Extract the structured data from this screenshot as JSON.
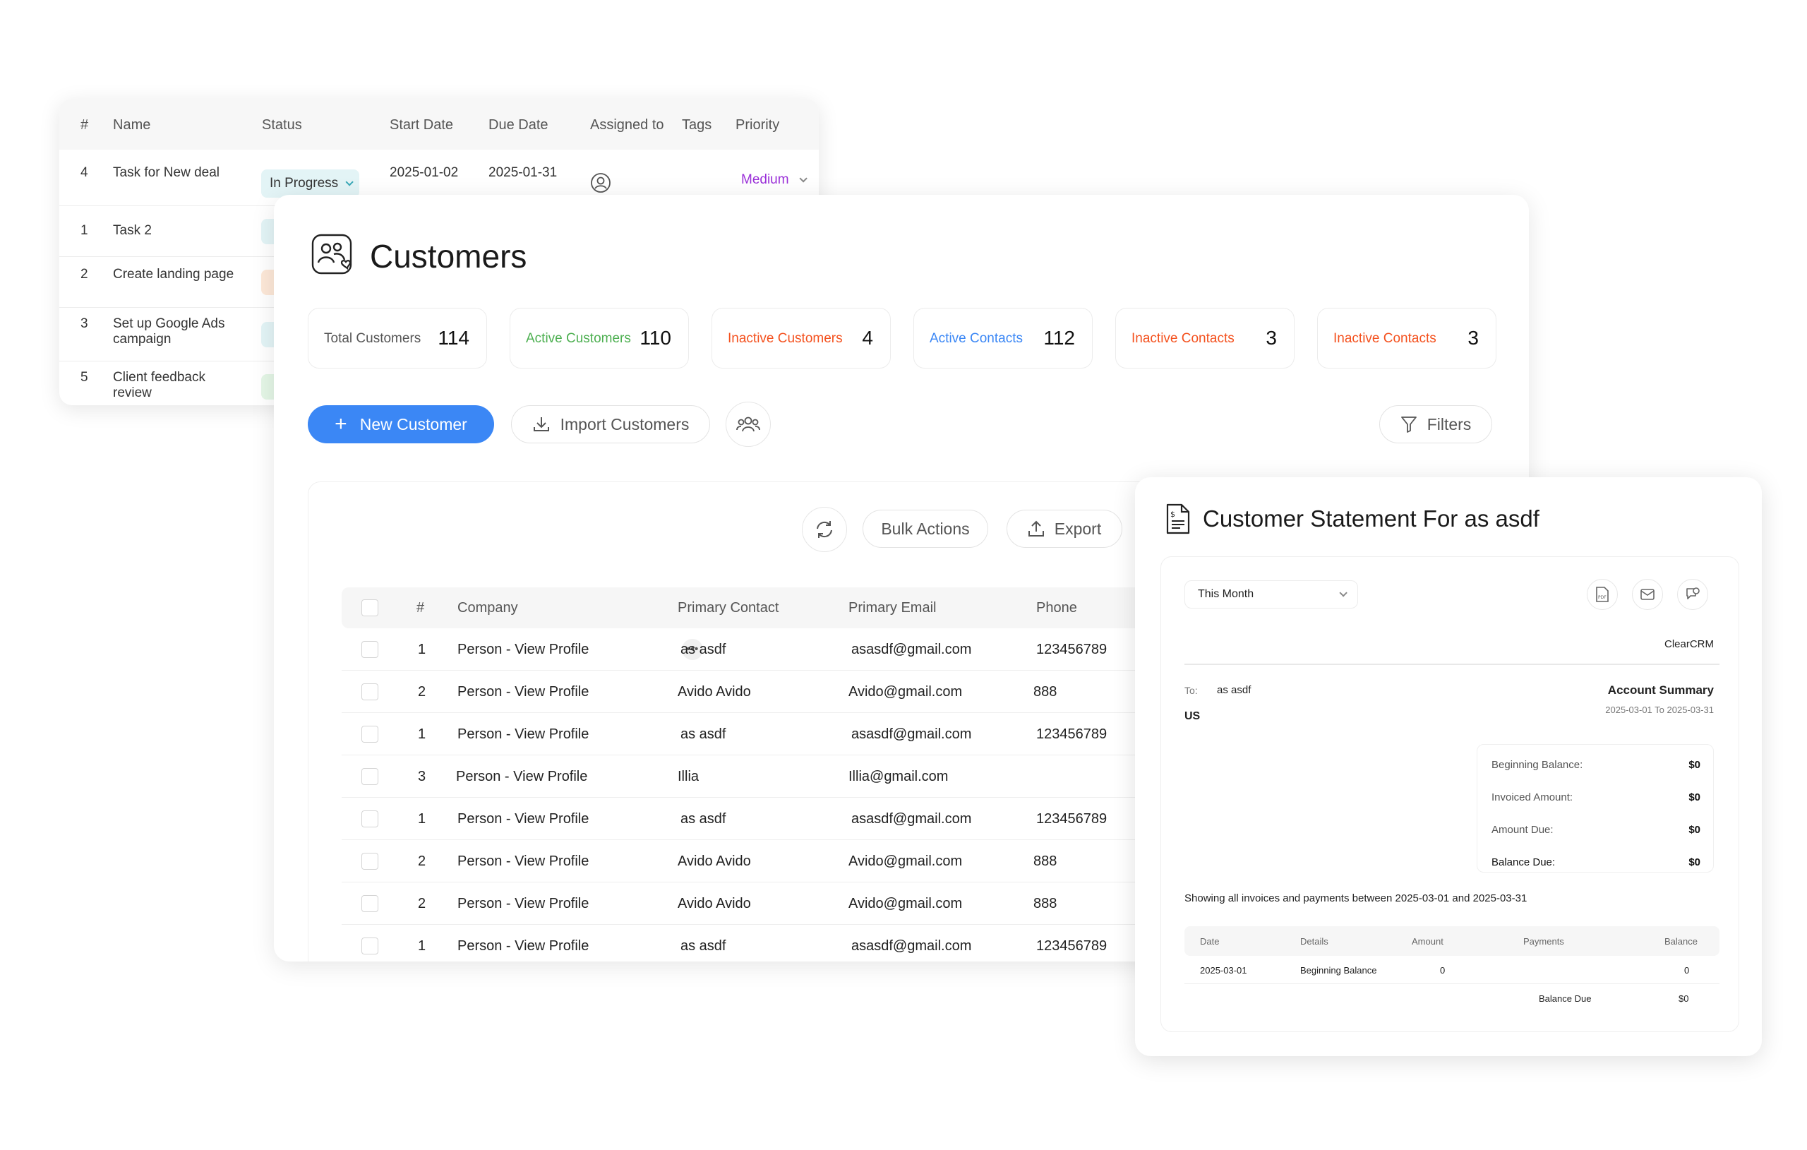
{
  "tasks": {
    "columns": [
      "#",
      "Name",
      "Status",
      "Start Date",
      "Due Date",
      "Assigned to",
      "Tags",
      "Priority"
    ],
    "rows": [
      {
        "num": "4",
        "name_line1": "Task for New deal",
        "name_line2": "",
        "status": "In Progress",
        "start": "2025-01-02",
        "due": "2025-01-31",
        "priority": "Medium"
      },
      {
        "num": "1",
        "name_line1": "Task 2",
        "name_line2": "",
        "status_color": "#e3f4f6"
      },
      {
        "num": "2",
        "name_line1": "Create landing page",
        "name_line2": "",
        "status_color": "#fde8d8"
      },
      {
        "num": "3",
        "name_line1": "Set up Google Ads",
        "name_line2": "campaign",
        "status_color": "#e3f4f6"
      },
      {
        "num": "5",
        "name_line1": "Client feedback",
        "name_line2": "review",
        "status_color": "#e4f6e6"
      }
    ]
  },
  "customers": {
    "title": "Customers",
    "stats": [
      {
        "label": "Total Customers",
        "value": "114",
        "color": "#555555"
      },
      {
        "label": "Active Customers",
        "value": "110",
        "color": "#4caf50"
      },
      {
        "label": "Inactive Customers",
        "value": "4",
        "color": "#f4511e"
      },
      {
        "label": "Active Contacts",
        "value": "112",
        "color": "#3b87f5"
      },
      {
        "label": "Inactive Contacts",
        "value": "3",
        "color": "#f4511e"
      },
      {
        "label": "Inactive Contacts",
        "value": "3",
        "color": "#f4511e"
      }
    ],
    "new_button": "New Customer",
    "import_button": "Import Customers",
    "filters_button": "Filters",
    "bulk_actions": "Bulk Actions",
    "export": "Export",
    "columns": [
      "#",
      "Company",
      "Primary Contact",
      "Primary Email",
      "Phone"
    ],
    "rows": [
      {
        "num": "1",
        "company": "Person - View Profile",
        "contact": "as asdf",
        "email": "asasdf@gmail.com",
        "phone": "123456789"
      },
      {
        "num": "2",
        "company": "Person - View Profile",
        "contact": "Avido Avido",
        "email": "Avido@gmail.com",
        "phone": "888"
      },
      {
        "num": "1",
        "company": "Person - View Profile",
        "contact": "as asdf",
        "email": "asasdf@gmail.com",
        "phone": "123456789"
      },
      {
        "num": "3",
        "company": "Person - View Profile",
        "contact": "Illia",
        "email": "Illia@gmail.com",
        "phone": ""
      },
      {
        "num": "1",
        "company": "Person - View Profile",
        "contact": "as asdf",
        "email": "asasdf@gmail.com",
        "phone": "123456789"
      },
      {
        "num": "2",
        "company": "Person - View Profile",
        "contact": "Avido Avido",
        "email": "Avido@gmail.com",
        "phone": "888"
      },
      {
        "num": "2",
        "company": "Person - View Profile",
        "contact": "Avido Avido",
        "email": "Avido@gmail.com",
        "phone": "888"
      },
      {
        "num": "1",
        "company": "Person - View Profile",
        "contact": "as asdf",
        "email": "asasdf@gmail.com",
        "phone": "123456789"
      }
    ]
  },
  "statement": {
    "title": "Customer Statement For as asdf",
    "period_select": "This Month",
    "company": "ClearCRM",
    "to_label": "To:",
    "to_name": "as asdf",
    "country": "US",
    "summary_title": "Account Summary",
    "summary_range": "2025-03-01 To 2025-03-31",
    "summary": [
      {
        "label": "Beginning Balance:",
        "value": "$0"
      },
      {
        "label": "Invoiced Amount:",
        "value": "$0"
      },
      {
        "label": "Amount Due:",
        "value": "$0"
      },
      {
        "label": "Balance Due:",
        "value": "$0"
      }
    ],
    "showing_text": "Showing all invoices and payments between 2025-03-01 and 2025-03-31",
    "columns": [
      "Date",
      "Details",
      "Amount",
      "Payments",
      "Balance"
    ],
    "row": {
      "date": "2025-03-01",
      "details": "Beginning Balance",
      "amount": "0",
      "payments": "",
      "balance": "0"
    },
    "footer_label": "Balance Due",
    "footer_value": "$0"
  }
}
